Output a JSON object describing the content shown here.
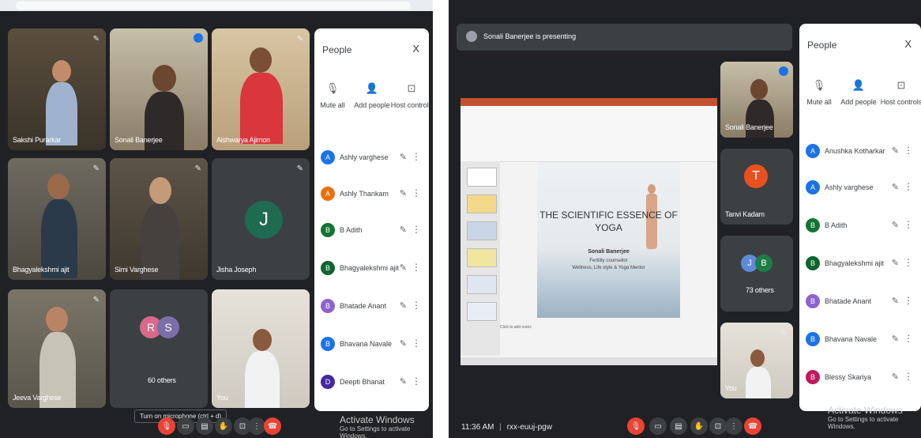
{
  "left_meeting": {
    "tiles": [
      {
        "name": "Sakshi Purarkar"
      },
      {
        "name": "Sonali Banerjee"
      },
      {
        "name": "Aishwarya Ajimon"
      },
      {
        "name": "Bhagyalekshmi ajit"
      },
      {
        "name": "Simi Varghese"
      },
      {
        "name": "Jisha Joseph",
        "avatar": "J",
        "avatar_color": "#1e6b52"
      },
      {
        "name": "Jeeva Varghese"
      },
      {
        "name": "60 others",
        "avatars": [
          "R",
          "S"
        ],
        "avatar_colors": [
          "#d56a8a",
          "#7a6fa8"
        ]
      },
      {
        "name": "You"
      }
    ],
    "tooltip": "Turn on microphone (ctrl + d)",
    "people_panel": {
      "title": "People",
      "close": "X",
      "actions": [
        "Mute all",
        "Add people",
        "Host controls"
      ],
      "participants": [
        {
          "initial": "A",
          "name": "Ashly varghese",
          "color": "#1a73e8"
        },
        {
          "initial": "A",
          "name": "Ashly Thankam",
          "color": "#e8710a"
        },
        {
          "initial": "B",
          "name": "B Adith",
          "color": "#137333"
        },
        {
          "initial": "B",
          "name": "Bhagyalekshmi ajit",
          "color": "#0d652d"
        },
        {
          "initial": "B",
          "name": "Bhatade Anant",
          "color": "#8e63ce"
        },
        {
          "initial": "B",
          "name": "Bhavana Navale",
          "color": "#1a73e8"
        },
        {
          "initial": "D",
          "name": "Deepti Bhanat",
          "color": "#4527a0"
        }
      ]
    },
    "activate": {
      "title": "Activate Windows",
      "subtitle": "Go to Settings to activate Windows."
    }
  },
  "right_meeting": {
    "presenting_text": "Sonali Banerjee is presenting",
    "slide": {
      "title_line1": "THE SCIENTIFIC ESSENCE OF",
      "title_line2": "YOGA",
      "presenter": "Sonali Banerjee",
      "role1": "Fertility counsellor",
      "role2": "Wellness, Life style & Yoga Mentor",
      "notes": "Click to add notes"
    },
    "side_tiles": [
      {
        "name": "Sonali Banerjee"
      },
      {
        "name": "Tanvi Kadam",
        "avatar": "T",
        "avatar_color": "#e8511f"
      },
      {
        "name": "73 others",
        "avatars": [
          "J",
          "B"
        ],
        "avatar_colors": [
          "#5f8ad9",
          "#1e7d45"
        ]
      },
      {
        "name": "You"
      }
    ],
    "people_panel": {
      "title": "People",
      "close": "X",
      "actions": [
        "Mute all",
        "Add people",
        "Host controls"
      ],
      "participants": [
        {
          "initial": "A",
          "name": "Anushka Kotharkar",
          "color": "#1a73e8"
        },
        {
          "initial": "A",
          "name": "Ashly varghese",
          "color": "#1a73e8"
        },
        {
          "initial": "B",
          "name": "B Adith",
          "color": "#137333"
        },
        {
          "initial": "B",
          "name": "Bhagyalekshmi ajit",
          "color": "#0d652d"
        },
        {
          "initial": "B",
          "name": "Bhatade Anant",
          "color": "#8e63ce"
        },
        {
          "initial": "B",
          "name": "Bhavana Navale",
          "color": "#1a73e8"
        },
        {
          "initial": "B",
          "name": "Blessy Skariya",
          "color": "#c2185b"
        }
      ]
    },
    "time": "11:36 AM",
    "separator": "|",
    "meeting_code": "rxx-euuj-pgw",
    "activate": {
      "title": "Activate Windows",
      "subtitle": "Go to Settings to activate Windows."
    }
  }
}
